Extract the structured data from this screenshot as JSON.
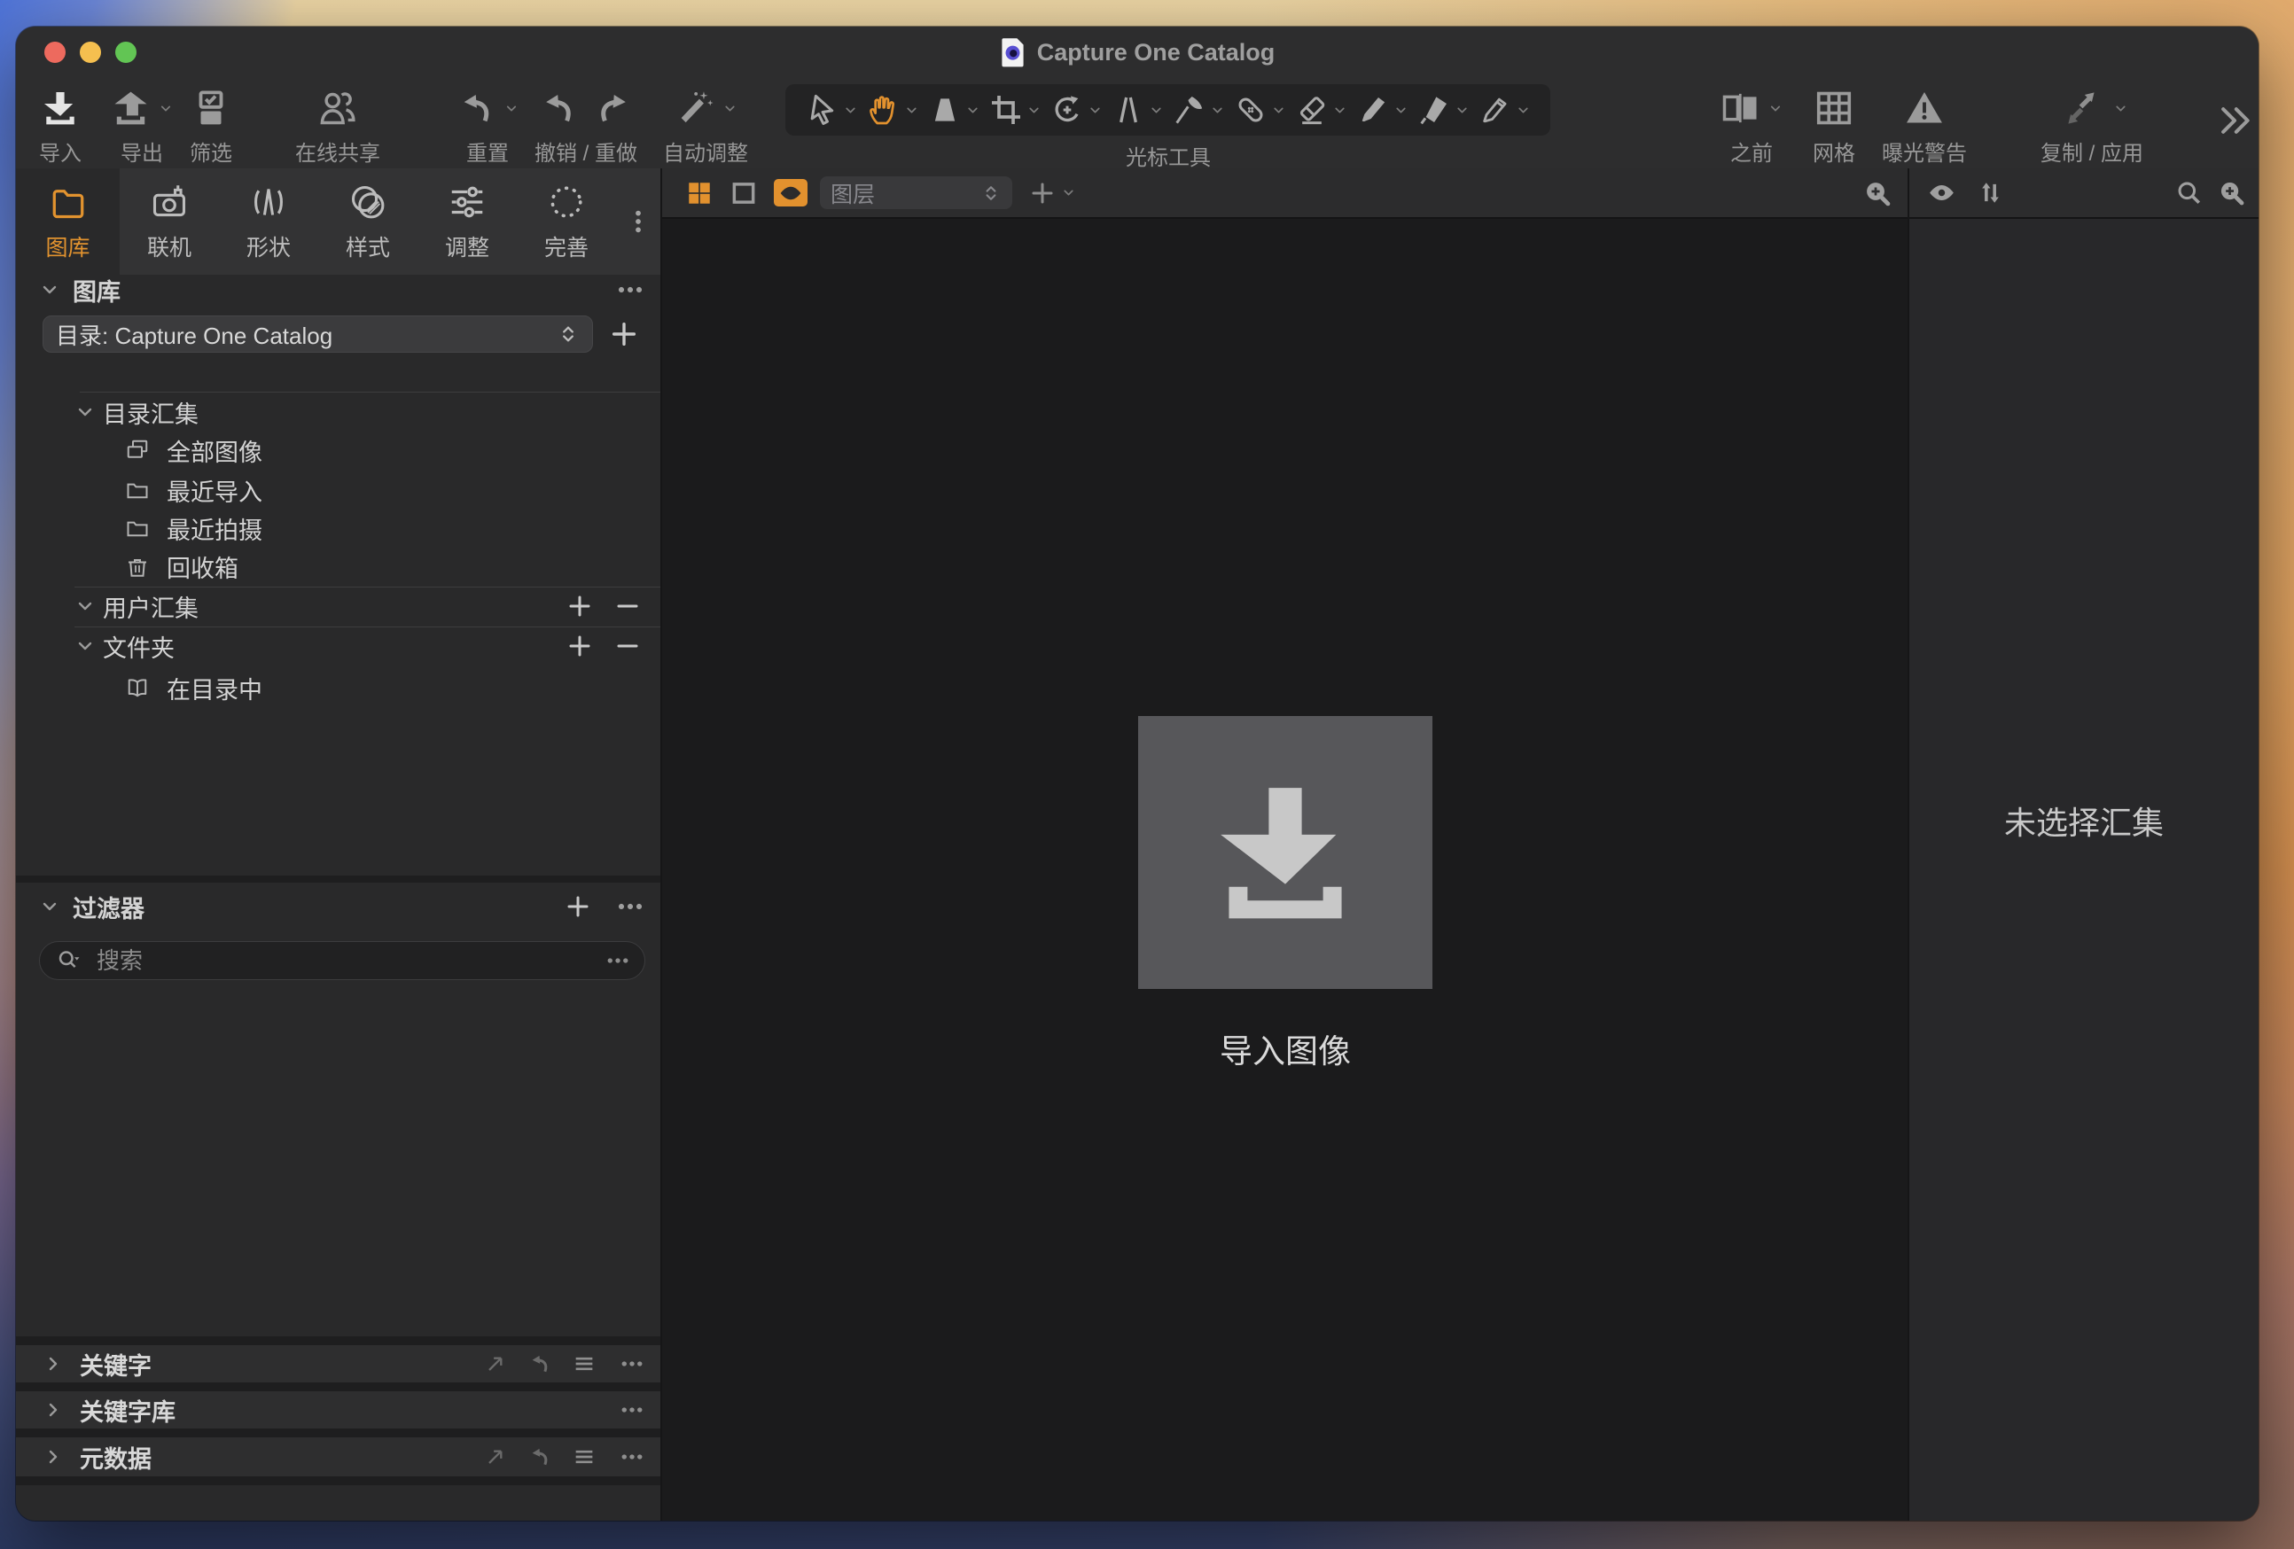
{
  "window": {
    "title": "Capture One Catalog"
  },
  "toolbar": {
    "import": {
      "label": "导入"
    },
    "export": {
      "label": "导出"
    },
    "filter": {
      "label": "筛选"
    },
    "share": {
      "label": "在线共享"
    },
    "reset": {
      "label": "重置"
    },
    "undo_redo": {
      "label": "撤销 / 重做"
    },
    "auto_adjust": {
      "label": "自动调整"
    },
    "cursor_tools": {
      "label": "光标工具"
    },
    "before": {
      "label": "之前"
    },
    "grid": {
      "label": "网格"
    },
    "exposure_warning": {
      "label": "曝光警告"
    },
    "copy_apply": {
      "label": "复制 / 应用"
    }
  },
  "sidebar": {
    "tabs": [
      {
        "label": "图库",
        "active": true
      },
      {
        "label": "联机",
        "active": false
      },
      {
        "label": "形状",
        "active": false
      },
      {
        "label": "样式",
        "active": false
      },
      {
        "label": "调整",
        "active": false
      },
      {
        "label": "完善",
        "active": false
      }
    ],
    "library": {
      "header": "图库",
      "catalog_select_value": "目录: Capture One Catalog",
      "catalog_collections": {
        "header": "目录汇集",
        "items": [
          {
            "label": "全部图像",
            "icon": "all-images-icon"
          },
          {
            "label": "最近导入",
            "icon": "folder-icon"
          },
          {
            "label": "最近拍摄",
            "icon": "folder-icon"
          },
          {
            "label": "回收箱",
            "icon": "trash-icon"
          }
        ]
      },
      "user_collections": {
        "header": "用户汇集"
      },
      "folders": {
        "header": "文件夹",
        "items": [
          {
            "label": "在目录中",
            "icon": "book-icon"
          }
        ]
      }
    },
    "filters": {
      "header": "过滤器",
      "search_placeholder": "搜索"
    },
    "bottom_panels": [
      {
        "label": "关键字"
      },
      {
        "label": "关键字库"
      },
      {
        "label": "元数据"
      }
    ]
  },
  "viewer": {
    "layers_select_value": "图层",
    "import_dropzone_label": "导入图像"
  },
  "right_panel": {
    "empty_state_text": "未选择汇集"
  },
  "colors": {
    "accent_orange": "#e2912e",
    "traffic_red": "#ed6a5e",
    "traffic_yellow": "#f5bf4f",
    "traffic_green": "#62c554",
    "viewer_background": "#1b1b1c",
    "panel_background": "#29292a"
  }
}
